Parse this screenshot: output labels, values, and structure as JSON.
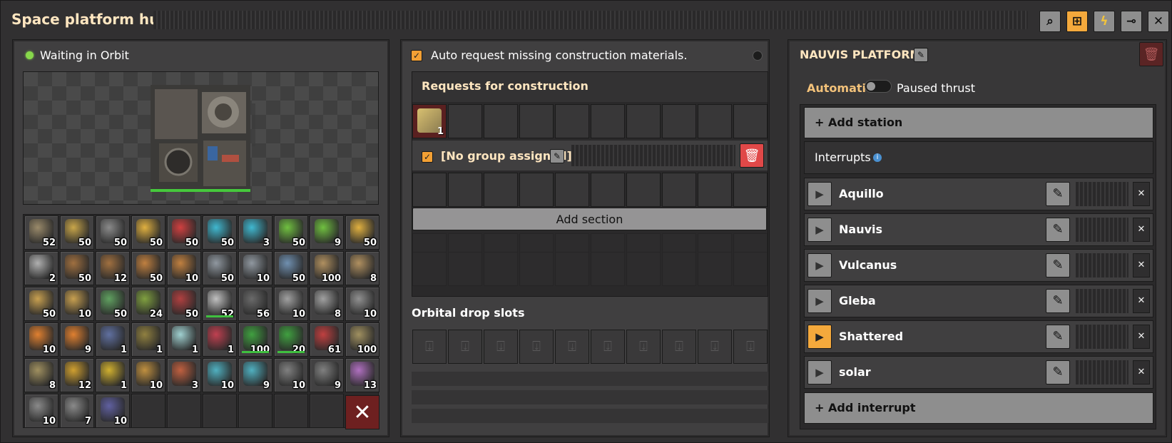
{
  "window": {
    "title": "Space platform hub"
  },
  "titlebar_buttons": [
    {
      "name": "search-icon",
      "glyph": "⌕"
    },
    {
      "name": "logistics-network-icon",
      "glyph": "♆"
    },
    {
      "name": "electricity-icon",
      "glyph": "ϟ"
    },
    {
      "name": "pin-icon",
      "glyph": "⊸"
    },
    {
      "name": "close-icon",
      "glyph": "✕"
    }
  ],
  "left": {
    "status": "Waiting in Orbit",
    "status_color": "#87d84b",
    "inventory": [
      {
        "icon": "#9a8a6a",
        "count": "52"
      },
      {
        "icon": "#c9a64a",
        "count": "50"
      },
      {
        "icon": "#8a8a8a",
        "count": "50"
      },
      {
        "icon": "#e0b040",
        "count": "50"
      },
      {
        "icon": "#d04040",
        "count": "50"
      },
      {
        "icon": "#40b8d0",
        "count": "50"
      },
      {
        "icon": "#40b8d0",
        "count": "3"
      },
      {
        "icon": "#70c040",
        "count": "50"
      },
      {
        "icon": "#70c040",
        "count": "9"
      },
      {
        "icon": "#e0b040",
        "count": "50"
      },
      {
        "icon": "#b0b0b0",
        "count": "2"
      },
      {
        "icon": "#a07040",
        "count": "50"
      },
      {
        "icon": "#a07040",
        "count": "12"
      },
      {
        "icon": "#c08040",
        "count": "50"
      },
      {
        "icon": "#c08040",
        "count": "10"
      },
      {
        "icon": "#9098a0",
        "count": "50"
      },
      {
        "icon": "#9098a0",
        "count": "10"
      },
      {
        "icon": "#7090b0",
        "count": "50"
      },
      {
        "icon": "#b09060",
        "count": "100"
      },
      {
        "icon": "#b09060",
        "count": "8"
      },
      {
        "icon": "#c8a050",
        "count": "50"
      },
      {
        "icon": "#c8a050",
        "count": "10"
      },
      {
        "icon": "#60a060",
        "count": "50"
      },
      {
        "icon": "#80a040",
        "count": "24"
      },
      {
        "icon": "#b04040",
        "count": "50"
      },
      {
        "icon": "#c0c0c0",
        "count": "52",
        "bar": true
      },
      {
        "icon": "#6a6a6a",
        "count": "56"
      },
      {
        "icon": "#a0a0a0",
        "count": "10"
      },
      {
        "icon": "#a0a0a0",
        "count": "8"
      },
      {
        "icon": "#909090",
        "count": "10"
      },
      {
        "icon": "#e08030",
        "count": "10"
      },
      {
        "icon": "#e08030",
        "count": "9"
      },
      {
        "icon": "#6070a0",
        "count": "1"
      },
      {
        "icon": "#908040",
        "count": "1"
      },
      {
        "icon": "#a0d0d0",
        "count": "1"
      },
      {
        "icon": "#c04050",
        "count": "1"
      },
      {
        "icon": "#40a040",
        "count": "100",
        "bar": true
      },
      {
        "icon": "#40a040",
        "count": "20",
        "bar": true
      },
      {
        "icon": "#c04040",
        "count": "61"
      },
      {
        "icon": "#a09060",
        "count": "100"
      },
      {
        "icon": "#a09060",
        "count": "8"
      },
      {
        "icon": "#d0a030",
        "count": "12"
      },
      {
        "icon": "#d0b030",
        "count": "1"
      },
      {
        "icon": "#c09040",
        "count": "10"
      },
      {
        "icon": "#c06040",
        "count": "3"
      },
      {
        "icon": "#50b0c0",
        "count": "10"
      },
      {
        "icon": "#50b0c0",
        "count": "9"
      },
      {
        "icon": "#808080",
        "count": "10"
      },
      {
        "icon": "#808080",
        "count": "9"
      },
      {
        "icon": "#b070c0",
        "count": "13"
      },
      {
        "icon": "#8a8a8a",
        "count": "10"
      },
      {
        "icon": "#8a8a8a",
        "count": "7"
      },
      {
        "icon": "#6060a0",
        "count": "10"
      },
      {
        "icon": "",
        "count": ""
      },
      {
        "icon": "",
        "count": ""
      },
      {
        "icon": "",
        "count": ""
      },
      {
        "icon": "",
        "count": ""
      },
      {
        "icon": "",
        "count": ""
      },
      {
        "icon": "",
        "count": ""
      }
    ]
  },
  "middle": {
    "auto_request_label": "Auto request missing construction materials.",
    "requests_title": "Requests for construction",
    "first_request_count": "1",
    "group_label": "[No group assigned]",
    "add_section_label": "Add section",
    "orbital_title": "Orbital drop slots"
  },
  "right": {
    "platform_name": "NAUVIS PLATFORM",
    "automatic_label": "Automatic",
    "paused_label": "Paused thrust",
    "add_station_label": "+ Add station",
    "interrupts_label": "Interrupts",
    "stations": [
      {
        "name": "Aquillo",
        "active": false
      },
      {
        "name": "Nauvis",
        "active": false
      },
      {
        "name": "Vulcanus",
        "active": false
      },
      {
        "name": "Gleba",
        "active": false
      },
      {
        "name": "Shattered",
        "active": true
      },
      {
        "name": "solar",
        "active": false
      }
    ],
    "add_interrupt_label": "+ Add interrupt"
  }
}
